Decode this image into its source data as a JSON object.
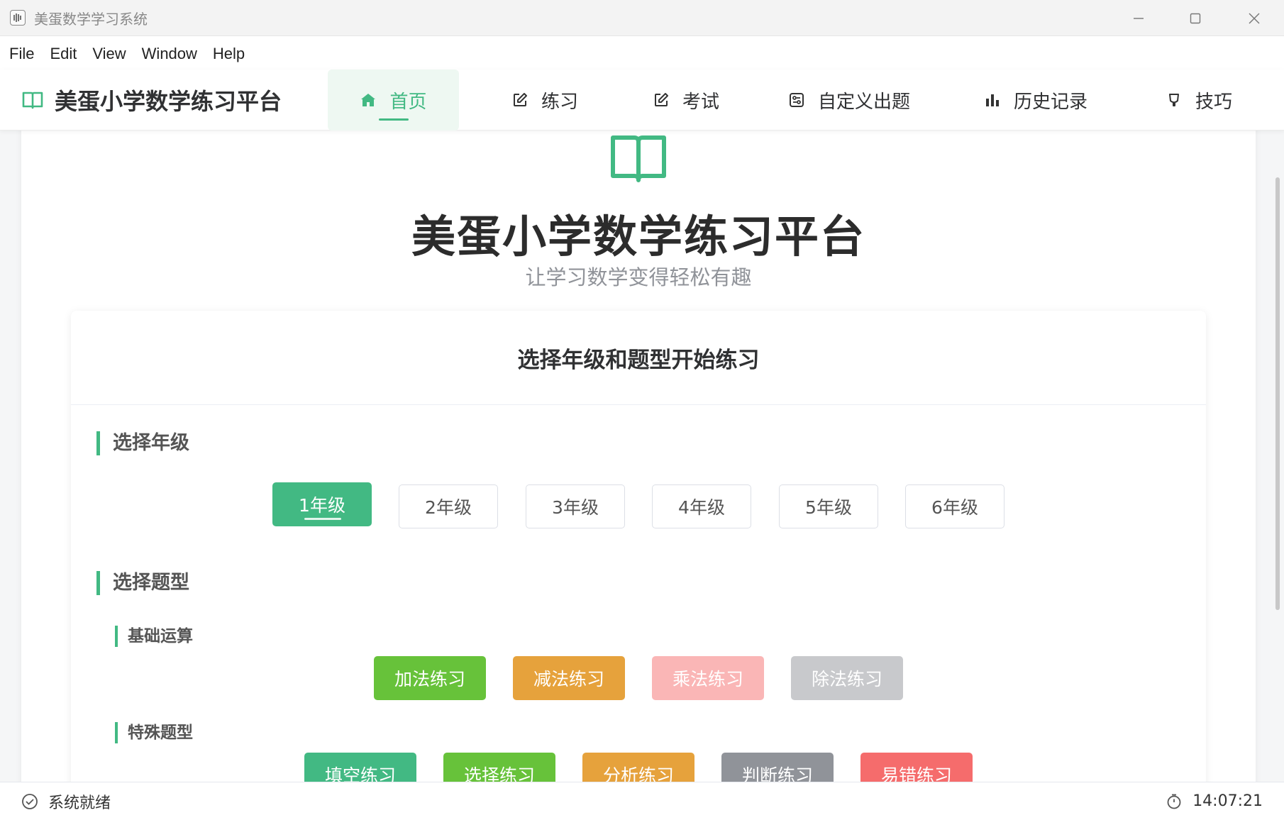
{
  "window": {
    "title": "美蛋数学学习系统",
    "controls": [
      "minimize",
      "maximize",
      "close"
    ]
  },
  "menu": [
    "File",
    "Edit",
    "View",
    "Window",
    "Help"
  ],
  "brand": {
    "name": "美蛋小学数学练习平台",
    "icon": "book-icon"
  },
  "nav": [
    {
      "label": "首页",
      "icon": "home-icon",
      "active": true
    },
    {
      "label": "练习",
      "icon": "edit-icon",
      "active": false
    },
    {
      "label": "考试",
      "icon": "edit-icon",
      "active": false
    },
    {
      "label": "自定义出题",
      "icon": "settings-panel-icon",
      "active": false
    },
    {
      "label": "历史记录",
      "icon": "bar-chart-icon",
      "active": false
    },
    {
      "label": "技巧",
      "icon": "lightbulb-icon",
      "active": false
    }
  ],
  "hero": {
    "title": "美蛋小学数学练习平台",
    "subtitle": "让学习数学变得轻松有趣",
    "icon": "book-icon"
  },
  "card": {
    "title": "选择年级和题型开始练习",
    "grade_section": "选择年级",
    "grades": [
      "1年级",
      "2年级",
      "3年级",
      "4年级",
      "5年级",
      "6年级"
    ],
    "selected_grade": "1年级",
    "type_section": "选择题型",
    "basic_group": "基础运算",
    "basic_types": [
      {
        "label": "加法练习",
        "color": "#67c23a"
      },
      {
        "label": "减法练习",
        "color": "#e6a23c"
      },
      {
        "label": "乘法练习",
        "color": "#fab6b6"
      },
      {
        "label": "除法练习",
        "color": "#c8c9cc"
      }
    ],
    "special_group": "特殊题型",
    "special_types": [
      {
        "label": "填空练习",
        "color": "#42b983"
      },
      {
        "label": "选择练习",
        "color": "#67c23a"
      },
      {
        "label": "分析练习",
        "color": "#e6a23c"
      },
      {
        "label": "判断练习",
        "color": "#909399"
      },
      {
        "label": "易错练习",
        "color": "#f56c6c"
      }
    ]
  },
  "status": {
    "message": "系统就绪",
    "time": "14:07:21"
  },
  "colors": {
    "accent": "#42b983",
    "title_bar": "#f3f3f3"
  }
}
